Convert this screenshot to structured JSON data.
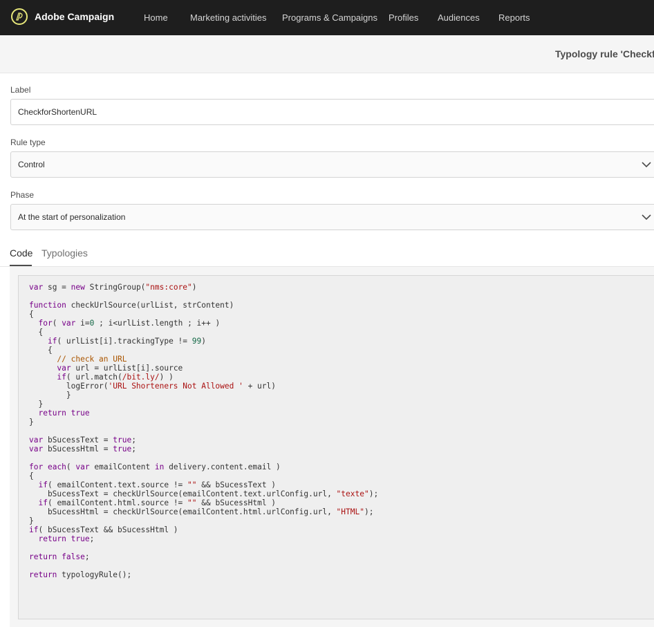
{
  "app": {
    "brand": "Adobe Campaign",
    "accent": "#e8e87a"
  },
  "nav": {
    "items": [
      "Home",
      "Marketing activities",
      "Programs & Campaigns",
      "Profiles",
      "Audiences",
      "Reports"
    ]
  },
  "header": {
    "title": "Typology rule 'Checkfor"
  },
  "form": {
    "label_caption": "Label",
    "label_value": "CheckforShortenURL",
    "rule_type_caption": "Rule type",
    "rule_type_value": "Control",
    "phase_caption": "Phase",
    "phase_value": "At the start of personalization"
  },
  "tabs": [
    "Code",
    "Typologies"
  ],
  "icons": {
    "chevron": "chevron-down-icon",
    "logo": "adobe-campaign-logo-icon"
  },
  "code": [
    "var sg = new StringGroup(\"nms:core\")",
    "",
    "function checkUrlSource(urlList, strContent)",
    "{",
    "  for( var i=0 ; i<urlList.length ; i++ )",
    "  {",
    "    if( urlList[i].trackingType != 99)",
    "    {",
    "      // check an URL",
    "      var url = urlList[i].source",
    "      if( url.match(/bit.ly/) )",
    "        logError('URL Shorteners Not Allowed ' + url)",
    "        }",
    "  }",
    "  return true",
    "}",
    "",
    "var bSucessText = true;",
    "var bSucessHtml = true;",
    "",
    "for each( var emailContent in delivery.content.email )",
    "{",
    "  if( emailContent.text.source != \"\" && bSucessText )",
    "    bSucessText = checkUrlSource(emailContent.text.urlConfig.url, \"texte\");",
    "  if( emailContent.html.source != \"\" && bSucessHtml )",
    "    bSucessHtml = checkUrlSource(emailContent.html.urlConfig.url, \"HTML\");",
    "}",
    "if( bSucessText && bSucessHtml )",
    "  return true;",
    "",
    "return false;",
    "",
    "return typologyRule();"
  ]
}
